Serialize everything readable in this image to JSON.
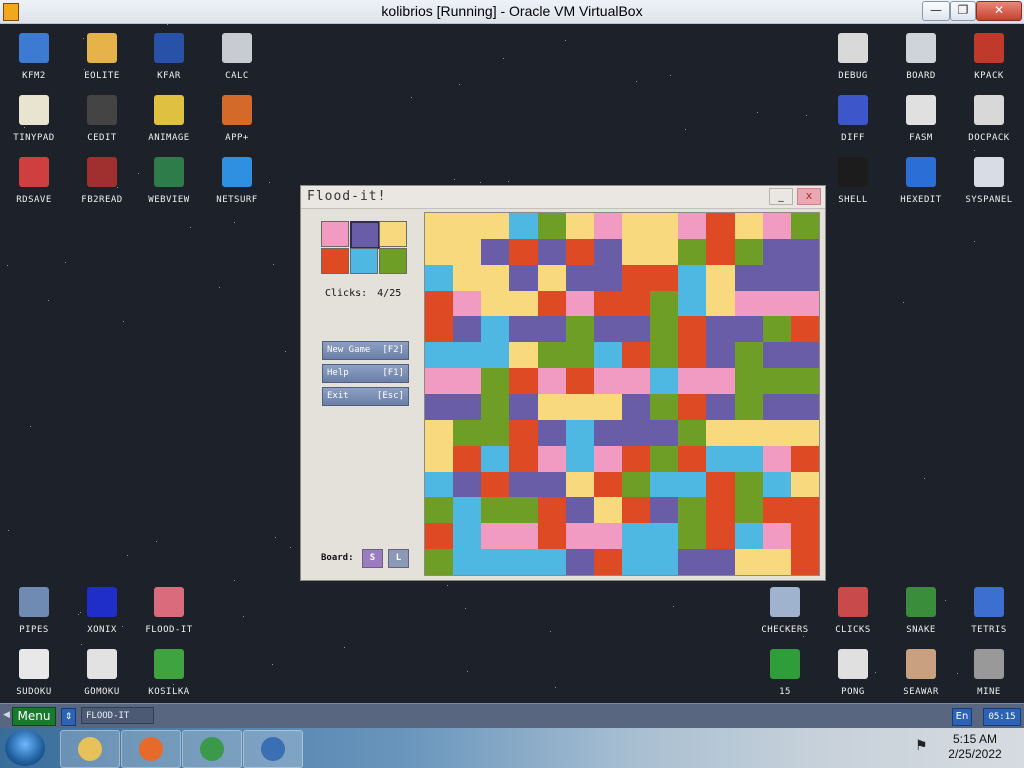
{
  "host": {
    "title": "kolibrios [Running] - Oracle VM VirtualBox",
    "controls": {
      "minimize": "—",
      "restore": "❐",
      "close": "✕"
    }
  },
  "desktop": {
    "left_icons": [
      {
        "label": "KFM2",
        "color": "#3d7ad1"
      },
      {
        "label": "EOLITE",
        "color": "#e6b34b"
      },
      {
        "label": "KFAR",
        "color": "#2852a8"
      },
      {
        "label": "CALC",
        "color": "#c8cbd2"
      },
      {
        "label": "TINYPAD",
        "color": "#e9e4d0"
      },
      {
        "label": "CEDIT",
        "color": "#444444"
      },
      {
        "label": "ANIMAGE",
        "color": "#e0c040"
      },
      {
        "label": "APP+",
        "color": "#d46a2a"
      },
      {
        "label": "RDSAVE",
        "color": "#cf3f3f"
      },
      {
        "label": "FB2READ",
        "color": "#a03030"
      },
      {
        "label": "WEBVIEW",
        "color": "#2d7c4a"
      },
      {
        "label": "NETSURF",
        "color": "#2f8fe0"
      }
    ],
    "right_icons": [
      {
        "label": "DEBUG",
        "color": "#d9d9d9"
      },
      {
        "label": "BOARD",
        "color": "#cfd3da"
      },
      {
        "label": "KPACK",
        "color": "#c0392b"
      },
      {
        "label": "DIFF",
        "color": "#3d56c9"
      },
      {
        "label": "FASM",
        "color": "#e0e0e0"
      },
      {
        "label": "DOCPACK",
        "color": "#d8d8d8"
      },
      {
        "label": "SHELL",
        "color": "#1c1c1c"
      },
      {
        "label": "HEXEDIT",
        "color": "#2b6fd6"
      },
      {
        "label": "SYSPANEL",
        "color": "#d8dde5"
      }
    ],
    "bottom_left_icons": [
      {
        "label": "PIPES",
        "color": "#6f8bb3"
      },
      {
        "label": "XONIX",
        "color": "#1f2dc9"
      },
      {
        "label": "FLOOD-IT",
        "color": "#d96b7c"
      },
      {
        "label": "SUDOKU",
        "color": "#e8e8e8"
      },
      {
        "label": "GOMOKU",
        "color": "#e2e2e2"
      },
      {
        "label": "KOSILKA",
        "color": "#3fa33f"
      }
    ],
    "bottom_right_icons": [
      {
        "label": "CHECKERS",
        "color": "#9fb3cf"
      },
      {
        "label": "CLICKS",
        "color": "#c94a4a"
      },
      {
        "label": "SNAKE",
        "color": "#3a8d3a"
      },
      {
        "label": "TETRIS",
        "color": "#3d6fd0"
      },
      {
        "label": "15",
        "color": "#2f9e3a"
      },
      {
        "label": "PONG",
        "color": "#e0e0e0"
      },
      {
        "label": "SEAWAR",
        "color": "#c9a080"
      },
      {
        "label": "MINE",
        "color": "#999999"
      }
    ]
  },
  "flood": {
    "title": "Flood-it!",
    "min_label": "_",
    "close_label": "x",
    "palette": [
      "#f19ac2",
      "#6a5da8",
      "#f9d97d",
      "#de4a24",
      "#4eb7e2",
      "#6f9e26"
    ],
    "selected_index": 1,
    "clicks_label": "Clicks:",
    "clicks_value": "4/25",
    "buttons": [
      {
        "label": "New Game",
        "key": "[F2]"
      },
      {
        "label": "Help",
        "key": "[F1]"
      },
      {
        "label": "Exit",
        "key": "[Esc]"
      }
    ],
    "board_label": "Board:",
    "size_s": "S",
    "size_l": "L",
    "grid": [
      "YYYBGYPYYPRYPG",
      "YYPRPRPYYGRGPP",
      "BYYPYPPRRBYPPP",
      "RPYYRPRRGBYPPP",
      "RPBPPGPPGRPPGR",
      "BBBYGGBRGRPGPP",
      "PPGRPRPPBPPGGG",
      "PPGPYYYPGRPGPP",
      "YGGRPBPPPGYYYY",
      "YRBRPBPRGRBBPR",
      "BPRPPYRGBBRGBY",
      "GBGGRPYRPGRGRR",
      "RBPPRPPBBGRBPR",
      "GBBBBPRBBPPYYR"
    ]
  },
  "kpanel": {
    "arrow": "◀",
    "menu": "Menu",
    "switch": "⇕",
    "task": "FLOOD-IT",
    "lang": "En",
    "time": "05:15"
  },
  "host_taskbar": {
    "time": "5:15 AM",
    "date": "2/25/2022",
    "apps": [
      {
        "name": "explorer",
        "color": "#e7c15a"
      },
      {
        "name": "firefox",
        "color": "#e66a2a"
      },
      {
        "name": "chrome",
        "color": "#3a9a4a"
      },
      {
        "name": "virtualbox",
        "color": "#3b6fb5"
      }
    ]
  }
}
